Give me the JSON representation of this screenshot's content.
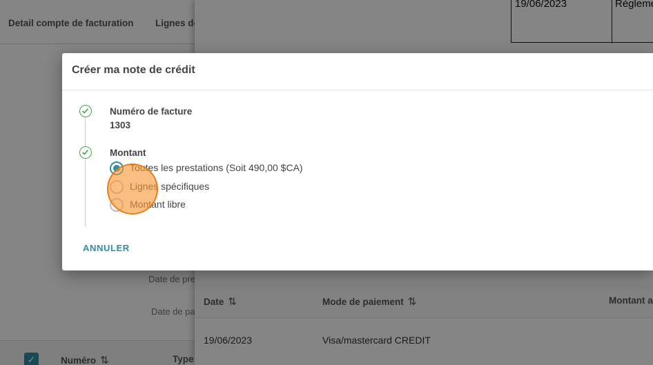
{
  "background_page": {
    "tabs": [
      "Detail compte de facturation",
      "Lignes de"
    ],
    "form_labels": [
      "Date de pre",
      "Date de pa"
    ],
    "summary_table": {
      "date": "19/06/2023",
      "method": "Règlement"
    },
    "left_table": {
      "columns": [
        "Numéro",
        "Type"
      ]
    },
    "payments_table": {
      "columns": [
        "Date",
        "Mode de paiement",
        "Montant a"
      ],
      "rows": [
        {
          "date": "19/06/2023",
          "method": "Visa/mastercard CREDIT"
        }
      ]
    }
  },
  "dialog": {
    "title": "Créer ma note de crédit",
    "steps": [
      {
        "title": "Numéro de facture",
        "value": "1303"
      },
      {
        "title": "Montant"
      }
    ],
    "amount_options": [
      {
        "label": "Toutes les prestations (Soit 490,00 $CA)",
        "selected": true
      },
      {
        "label": "Lignes spécifiques",
        "selected": false
      },
      {
        "label": "Montant libre",
        "selected": false
      }
    ],
    "cancel_label": "ANNULER"
  },
  "colors": {
    "accent": "#2c8fa6",
    "step_complete": "#3ea24a",
    "overlay": "rgba(0,0,0,0.48)",
    "click_indicator": "#f5962f"
  }
}
